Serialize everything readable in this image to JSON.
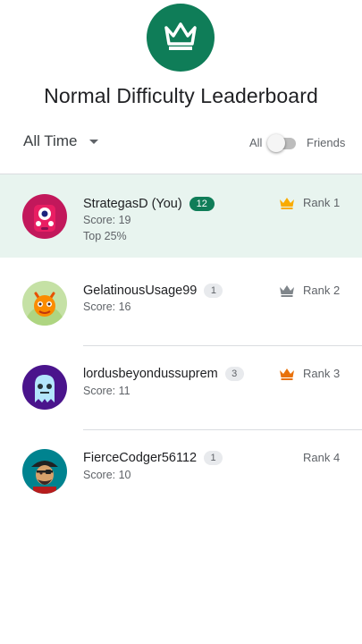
{
  "header": {
    "icon": "crown-icon",
    "title": "Normal Difficulty Leaderboard",
    "accent_color": "#0f7d58"
  },
  "filters": {
    "time_range": "All Time",
    "toggle_left_label": "All",
    "toggle_right_label": "Friends",
    "toggle_state": "All"
  },
  "players": [
    {
      "name": "StrategasD (You)",
      "level": "12",
      "score": "Score: 19",
      "percentile": "Top 25%",
      "rank": "Rank 1",
      "crown": "gold",
      "avatar": "pink-monster-avatar"
    },
    {
      "name": "GelatinousUsage99",
      "level": "1",
      "score": "Score: 16",
      "rank": "Rank 2",
      "crown": "silver",
      "avatar": "orange-dragon-avatar"
    },
    {
      "name": "lordusbeyondussuprem",
      "level": "3",
      "score": "Score: 11",
      "rank": "Rank 3",
      "crown": "bronze",
      "avatar": "ghost-avatar"
    },
    {
      "name": "FierceCodger56112",
      "level": "1",
      "score": "Score: 10",
      "rank": "Rank 4",
      "crown": "none",
      "avatar": "pirate-avatar"
    }
  ],
  "colors": {
    "gold": "#f9ab00",
    "silver": "#80868b",
    "bronze": "#e8710a",
    "highlight_row": "#e8f4ef"
  }
}
